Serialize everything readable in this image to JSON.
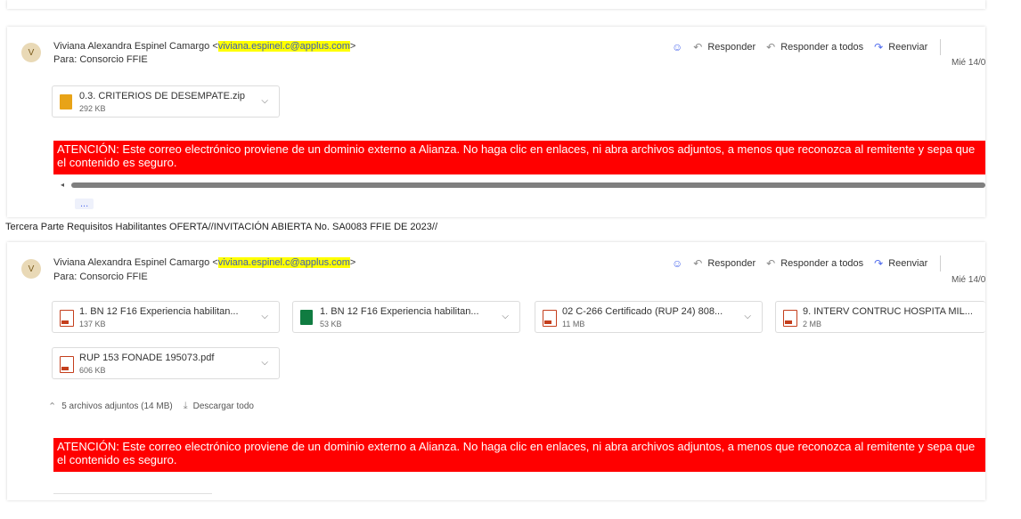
{
  "email1": {
    "avatar": "V",
    "sender_name": "Viviana Alexandra Espinel Camargo <",
    "sender_email": "viviana.espinel.c@applus.com",
    "sender_close": ">",
    "to": "Para: Consorcio FFIE",
    "actions": {
      "reply": "Responder",
      "reply_all": "Responder a todos",
      "forward": "Reenviar"
    },
    "date": "Mié 14/0",
    "attachments": [
      {
        "name": "0.3. CRITERIOS DE DESEMPATE.zip",
        "size": "292 KB",
        "type": "zip"
      }
    ],
    "warning": "ATENCIÓN: Este correo electrónico proviene de un dominio externo a Alianza. No haga clic en enlaces, ni abra archivos adjuntos, a menos que reconozca al remitente y sepa que el contenido es seguro.",
    "more": "..."
  },
  "subject": "Tercera  Parte  Requisitos Habilitantes OFERTA//INVITACIÓN ABIERTA No. SA0083 FFIE DE 2023//",
  "email2": {
    "avatar": "V",
    "sender_name": "Viviana Alexandra Espinel Camargo <",
    "sender_email": "viviana.espinel.c@applus.com",
    "sender_close": ">",
    "to": "Para: Consorcio FFIE",
    "actions": {
      "reply": "Responder",
      "reply_all": "Responder a todos",
      "forward": "Reenviar"
    },
    "date": "Mié 14/0",
    "attachments": [
      {
        "name": "1. BN 12 F16 Experiencia habilitan...",
        "size": "137 KB",
        "type": "pdf"
      },
      {
        "name": "1. BN 12 F16 Experiencia habilitan...",
        "size": "53 KB",
        "type": "xlsx"
      },
      {
        "name": "02 C-266 Certificado (RUP 24) 808...",
        "size": "11 MB",
        "type": "pdf"
      },
      {
        "name": "9. INTERV CONTRUC HOSPITA MIL...",
        "size": "2 MB",
        "type": "pdf"
      },
      {
        "name": "RUP 153 FONADE 195073.pdf",
        "size": "606 KB",
        "type": "pdf"
      }
    ],
    "summary": "5 archivos adjuntos (14 MB)",
    "download_all": "Descargar todo",
    "warning": "ATENCIÓN: Este correo electrónico proviene de un dominio externo a Alianza. No haga clic en enlaces, ni abra archivos adjuntos, a menos que reconozca al remitente y sepa que el contenido es seguro."
  }
}
